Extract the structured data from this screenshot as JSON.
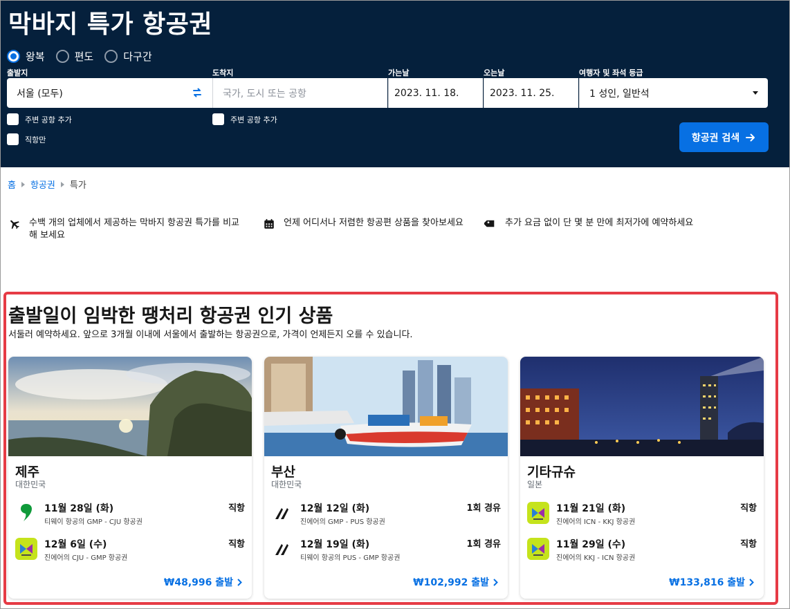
{
  "header": {
    "title": "막바지 특가 항공권",
    "trip_types": [
      {
        "label": "왕복",
        "selected": true
      },
      {
        "label": "편도",
        "selected": false
      },
      {
        "label": "다구간",
        "selected": false
      }
    ]
  },
  "search": {
    "origin_label": "출발지",
    "origin_value": "서울 (모두)",
    "dest_label": "도착지",
    "dest_placeholder": "국가, 도시 또는 공항",
    "depart_label": "가는날",
    "depart_value": "2023. 11. 18.",
    "return_label": "오는날",
    "return_value": "2023. 11. 25.",
    "pax_label": "여행자 및 좌석 등급",
    "pax_value": "1 성인, 일반석",
    "nearby_origin": "주변 공항 추가",
    "nearby_dest": "주변 공항 추가",
    "direct_only": "직항만",
    "button_label": "항공권 검색"
  },
  "breadcrumb": {
    "home": "홈",
    "flights": "항공권",
    "current": "특가"
  },
  "features": [
    {
      "icon": "airplane-icon",
      "text1": "수백 개의 업체에서 제공하는 막바지 항공권 특가를 비교",
      "text2": "해 보세요"
    },
    {
      "icon": "calendar-icon",
      "text1": "언제 어디서나 저렴한 항공편 상품을 찾아보세요"
    },
    {
      "icon": "tag-icon",
      "text1": "추가 요금 없이 단 몇 분 만에 최저가에 예약하세요"
    }
  ],
  "section": {
    "title": "출발일이 임박한 땡처리 항공권 인기 상품",
    "subtitle": "서둘러 예약하세요. 앞으로 3개월 이내에 서울에서 출발하는 항공권으로, 가격이 언제든지 오를 수 있습니다."
  },
  "cards": [
    {
      "city": "제주",
      "country": "대한민국",
      "legs": [
        {
          "date": "11월 28일 (화)",
          "route": "티웨이 항공의 GMP - CJU 항공권",
          "stops": "직항",
          "logo": "tway-logo"
        },
        {
          "date": "12월 6일 (수)",
          "route": "진에어의 CJU - GMP 항공권",
          "stops": "직항",
          "logo": "jinair-logo"
        }
      ],
      "price": "₩48,996 출발"
    },
    {
      "city": "부산",
      "country": "대한민국",
      "legs": [
        {
          "date": "12월 12일 (화)",
          "route": "진에어의 GMP - PUS 항공권",
          "stops": "1회 경유",
          "logo": "multi-airline-logo"
        },
        {
          "date": "12월 19일 (화)",
          "route": "티웨이 항공의 PUS - GMP 항공권",
          "stops": "1회 경유",
          "logo": "multi-airline-logo"
        }
      ],
      "price": "₩102,992 출발"
    },
    {
      "city": "기타규슈",
      "country": "일본",
      "legs": [
        {
          "date": "11월 21일 (화)",
          "route": "진에어의 ICN - KKJ 항공권",
          "stops": "직항",
          "logo": "jinair-logo"
        },
        {
          "date": "11월 29일 (수)",
          "route": "진에어의 KKJ - ICN 항공권",
          "stops": "직항",
          "logo": "jinair-logo"
        }
      ],
      "price": "₩133,816 출발"
    }
  ],
  "colors": {
    "header_bg": "#05203c",
    "accent": "#0770e3",
    "highlight_border": "#e63b45",
    "jinair_bg": "#c5e31c",
    "tway_red": "#d11f3e"
  }
}
